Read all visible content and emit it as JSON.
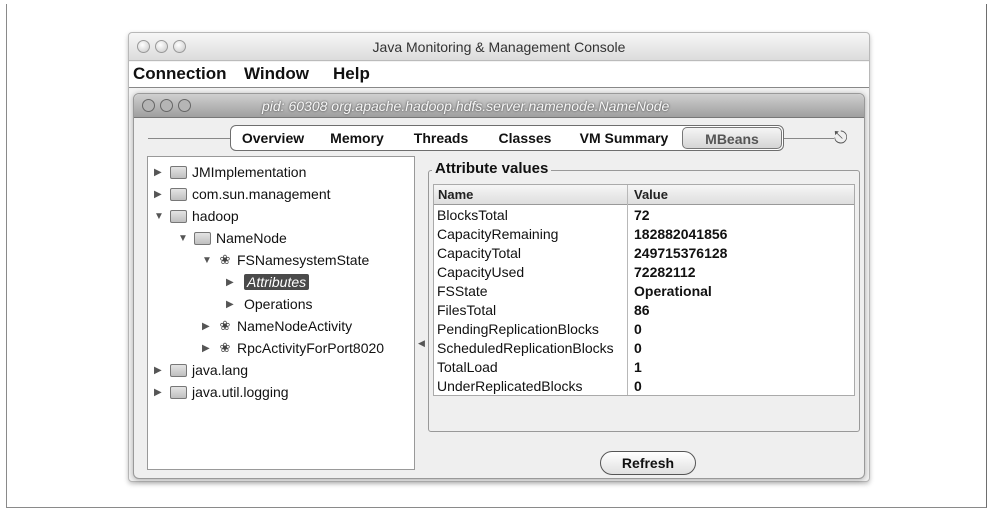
{
  "window": {
    "title": "Java Monitoring & Management Console"
  },
  "menu": [
    "Connection",
    "Window",
    "Help"
  ],
  "inner_window": {
    "title": "pid: 60308 org.apache.hadoop.hdfs.server.namenode.NameNode"
  },
  "tabs": [
    {
      "label": "Overview",
      "active": false
    },
    {
      "label": "Memory",
      "active": false
    },
    {
      "label": "Threads",
      "active": false
    },
    {
      "label": "Classes",
      "active": false
    },
    {
      "label": "VM Summary",
      "active": false
    },
    {
      "label": "MBeans",
      "active": true
    }
  ],
  "tree": [
    {
      "label": "JMImplementation",
      "icon": "folder-icon",
      "expanded": false
    },
    {
      "label": "com.sun.management",
      "icon": "folder-icon",
      "expanded": false
    },
    {
      "label": "hadoop",
      "icon": "folder-icon",
      "expanded": true
    },
    {
      "label": "NameNode",
      "icon": "folder-icon",
      "expanded": true
    },
    {
      "label": "FSNamesystemState",
      "icon": "mbean-icon",
      "expanded": true
    },
    {
      "label": "Attributes",
      "icon": "",
      "expanded": false,
      "selected": true
    },
    {
      "label": "Operations",
      "icon": "",
      "expanded": false
    },
    {
      "label": "NameNodeActivity",
      "icon": "mbean-icon",
      "expanded": false
    },
    {
      "label": "RpcActivityForPort8020",
      "icon": "mbean-icon",
      "expanded": false
    },
    {
      "label": "java.lang",
      "icon": "folder-icon",
      "expanded": false
    },
    {
      "label": "java.util.logging",
      "icon": "folder-icon",
      "expanded": false
    }
  ],
  "attributes": {
    "title": "Attribute values",
    "columns": [
      "Name",
      "Value"
    ],
    "rows": [
      {
        "name": "BlocksTotal",
        "value": "72"
      },
      {
        "name": "CapacityRemaining",
        "value": "182882041856"
      },
      {
        "name": "CapacityTotal",
        "value": "249715376128"
      },
      {
        "name": "CapacityUsed",
        "value": "72282112"
      },
      {
        "name": "FSState",
        "value": "Operational"
      },
      {
        "name": "FilesTotal",
        "value": "86"
      },
      {
        "name": "PendingReplicationBlocks",
        "value": "0"
      },
      {
        "name": "ScheduledReplicationBlocks",
        "value": "0"
      },
      {
        "name": "TotalLoad",
        "value": "1"
      },
      {
        "name": "UnderReplicatedBlocks",
        "value": "0"
      }
    ]
  },
  "refresh_label": "Refresh"
}
